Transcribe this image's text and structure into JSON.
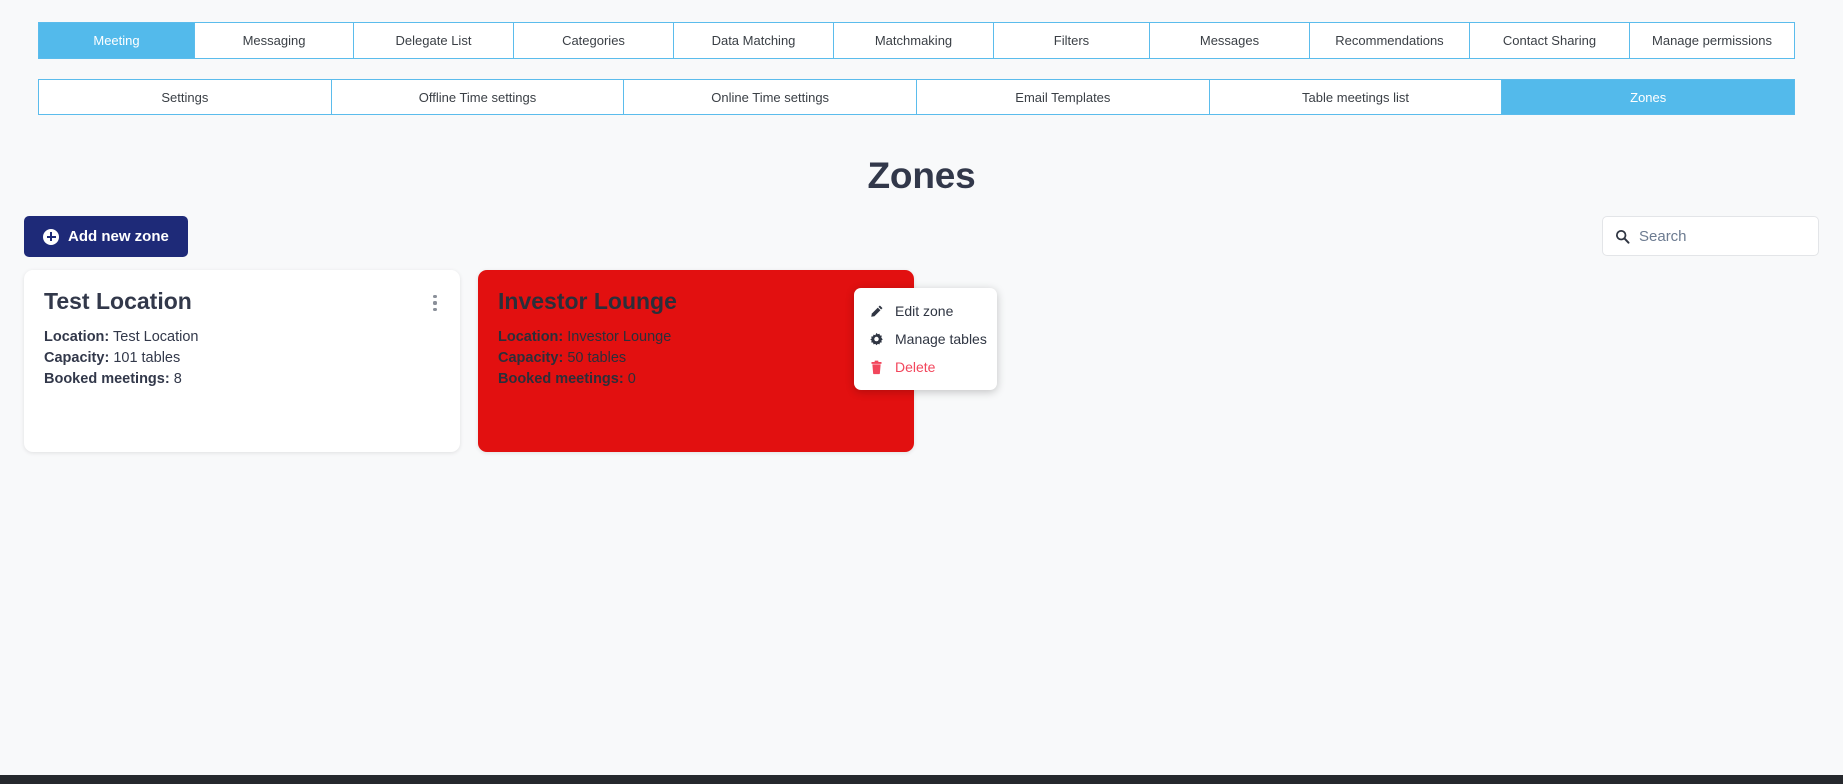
{
  "primary_tabs": [
    {
      "label": "Meeting",
      "active": true
    },
    {
      "label": "Messaging",
      "active": false
    },
    {
      "label": "Delegate List",
      "active": false
    },
    {
      "label": "Categories",
      "active": false
    },
    {
      "label": "Data Matching",
      "active": false
    },
    {
      "label": "Matchmaking",
      "active": false
    },
    {
      "label": "Filters",
      "active": false
    },
    {
      "label": "Messages",
      "active": false
    },
    {
      "label": "Recommendations",
      "active": false
    },
    {
      "label": "Contact Sharing",
      "active": false
    },
    {
      "label": "Manage permissions",
      "active": false
    }
  ],
  "secondary_tabs": [
    {
      "label": "Settings",
      "active": false
    },
    {
      "label": "Offline Time settings",
      "active": false
    },
    {
      "label": "Online Time settings",
      "active": false
    },
    {
      "label": "Email Templates",
      "active": false
    },
    {
      "label": "Table meetings list",
      "active": false
    },
    {
      "label": "Zones",
      "active": true
    }
  ],
  "page": {
    "title": "Zones"
  },
  "toolbar": {
    "add_zone_label": "Add new zone",
    "add_zone_icon": "plus-circle-icon"
  },
  "search": {
    "value": "",
    "placeholder": "Search",
    "icon": "search-icon"
  },
  "zones": [
    {
      "name": "Test Location",
      "location_label": "Location:",
      "location_value": "Test Location",
      "capacity_label": "Capacity:",
      "capacity_value": "101 tables",
      "booked_label": "Booked meetings:",
      "booked_value": "8",
      "highlighted": false
    },
    {
      "name": "Investor Lounge",
      "location_label": "Location:",
      "location_value": "Investor Lounge",
      "capacity_label": "Capacity:",
      "capacity_value": "50 tables",
      "booked_label": "Booked meetings:",
      "booked_value": "0",
      "highlighted": true
    }
  ],
  "zone_menu": {
    "items": [
      {
        "label": "Edit zone",
        "icon": "pencil-icon",
        "danger": false
      },
      {
        "label": "Manage tables",
        "icon": "gear-icon",
        "danger": false
      },
      {
        "label": "Delete",
        "icon": "trash-icon",
        "danger": true
      }
    ]
  },
  "colors": {
    "accent_blue": "#53baeb",
    "button_navy": "#1e2a78",
    "card_red": "#e21010",
    "danger_red": "#f2465c",
    "page_bg": "#f8f9fa",
    "footer_bar": "#25282d"
  }
}
